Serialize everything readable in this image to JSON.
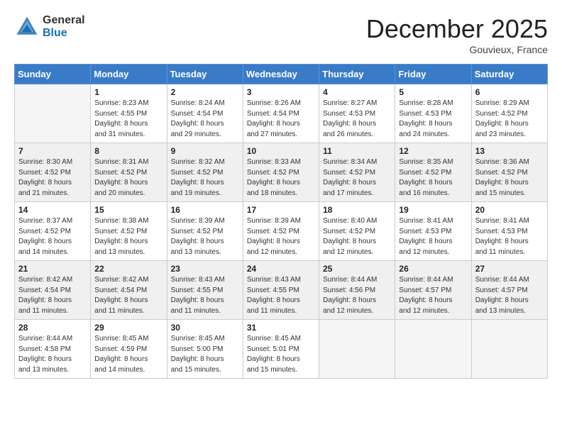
{
  "header": {
    "logo_general": "General",
    "logo_blue": "Blue",
    "month_title": "December 2025",
    "location": "Gouvieux, France"
  },
  "weekdays": [
    "Sunday",
    "Monday",
    "Tuesday",
    "Wednesday",
    "Thursday",
    "Friday",
    "Saturday"
  ],
  "weeks": [
    [
      {
        "day": "",
        "sunrise": "",
        "sunset": "",
        "daylight": ""
      },
      {
        "day": "1",
        "sunrise": "Sunrise: 8:23 AM",
        "sunset": "Sunset: 4:55 PM",
        "daylight": "Daylight: 8 hours and 31 minutes."
      },
      {
        "day": "2",
        "sunrise": "Sunrise: 8:24 AM",
        "sunset": "Sunset: 4:54 PM",
        "daylight": "Daylight: 8 hours and 29 minutes."
      },
      {
        "day": "3",
        "sunrise": "Sunrise: 8:26 AM",
        "sunset": "Sunset: 4:54 PM",
        "daylight": "Daylight: 8 hours and 27 minutes."
      },
      {
        "day": "4",
        "sunrise": "Sunrise: 8:27 AM",
        "sunset": "Sunset: 4:53 PM",
        "daylight": "Daylight: 8 hours and 26 minutes."
      },
      {
        "day": "5",
        "sunrise": "Sunrise: 8:28 AM",
        "sunset": "Sunset: 4:53 PM",
        "daylight": "Daylight: 8 hours and 24 minutes."
      },
      {
        "day": "6",
        "sunrise": "Sunrise: 8:29 AM",
        "sunset": "Sunset: 4:52 PM",
        "daylight": "Daylight: 8 hours and 23 minutes."
      }
    ],
    [
      {
        "day": "7",
        "sunrise": "Sunrise: 8:30 AM",
        "sunset": "Sunset: 4:52 PM",
        "daylight": "Daylight: 8 hours and 21 minutes."
      },
      {
        "day": "8",
        "sunrise": "Sunrise: 8:31 AM",
        "sunset": "Sunset: 4:52 PM",
        "daylight": "Daylight: 8 hours and 20 minutes."
      },
      {
        "day": "9",
        "sunrise": "Sunrise: 8:32 AM",
        "sunset": "Sunset: 4:52 PM",
        "daylight": "Daylight: 8 hours and 19 minutes."
      },
      {
        "day": "10",
        "sunrise": "Sunrise: 8:33 AM",
        "sunset": "Sunset: 4:52 PM",
        "daylight": "Daylight: 8 hours and 18 minutes."
      },
      {
        "day": "11",
        "sunrise": "Sunrise: 8:34 AM",
        "sunset": "Sunset: 4:52 PM",
        "daylight": "Daylight: 8 hours and 17 minutes."
      },
      {
        "day": "12",
        "sunrise": "Sunrise: 8:35 AM",
        "sunset": "Sunset: 4:52 PM",
        "daylight": "Daylight: 8 hours and 16 minutes."
      },
      {
        "day": "13",
        "sunrise": "Sunrise: 8:36 AM",
        "sunset": "Sunset: 4:52 PM",
        "daylight": "Daylight: 8 hours and 15 minutes."
      }
    ],
    [
      {
        "day": "14",
        "sunrise": "Sunrise: 8:37 AM",
        "sunset": "Sunset: 4:52 PM",
        "daylight": "Daylight: 8 hours and 14 minutes."
      },
      {
        "day": "15",
        "sunrise": "Sunrise: 8:38 AM",
        "sunset": "Sunset: 4:52 PM",
        "daylight": "Daylight: 8 hours and 13 minutes."
      },
      {
        "day": "16",
        "sunrise": "Sunrise: 8:39 AM",
        "sunset": "Sunset: 4:52 PM",
        "daylight": "Daylight: 8 hours and 13 minutes."
      },
      {
        "day": "17",
        "sunrise": "Sunrise: 8:39 AM",
        "sunset": "Sunset: 4:52 PM",
        "daylight": "Daylight: 8 hours and 12 minutes."
      },
      {
        "day": "18",
        "sunrise": "Sunrise: 8:40 AM",
        "sunset": "Sunset: 4:52 PM",
        "daylight": "Daylight: 8 hours and 12 minutes."
      },
      {
        "day": "19",
        "sunrise": "Sunrise: 8:41 AM",
        "sunset": "Sunset: 4:53 PM",
        "daylight": "Daylight: 8 hours and 12 minutes."
      },
      {
        "day": "20",
        "sunrise": "Sunrise: 8:41 AM",
        "sunset": "Sunset: 4:53 PM",
        "daylight": "Daylight: 8 hours and 11 minutes."
      }
    ],
    [
      {
        "day": "21",
        "sunrise": "Sunrise: 8:42 AM",
        "sunset": "Sunset: 4:54 PM",
        "daylight": "Daylight: 8 hours and 11 minutes."
      },
      {
        "day": "22",
        "sunrise": "Sunrise: 8:42 AM",
        "sunset": "Sunset: 4:54 PM",
        "daylight": "Daylight: 8 hours and 11 minutes."
      },
      {
        "day": "23",
        "sunrise": "Sunrise: 8:43 AM",
        "sunset": "Sunset: 4:55 PM",
        "daylight": "Daylight: 8 hours and 11 minutes."
      },
      {
        "day": "24",
        "sunrise": "Sunrise: 8:43 AM",
        "sunset": "Sunset: 4:55 PM",
        "daylight": "Daylight: 8 hours and 11 minutes."
      },
      {
        "day": "25",
        "sunrise": "Sunrise: 8:44 AM",
        "sunset": "Sunset: 4:56 PM",
        "daylight": "Daylight: 8 hours and 12 minutes."
      },
      {
        "day": "26",
        "sunrise": "Sunrise: 8:44 AM",
        "sunset": "Sunset: 4:57 PM",
        "daylight": "Daylight: 8 hours and 12 minutes."
      },
      {
        "day": "27",
        "sunrise": "Sunrise: 8:44 AM",
        "sunset": "Sunset: 4:57 PM",
        "daylight": "Daylight: 8 hours and 13 minutes."
      }
    ],
    [
      {
        "day": "28",
        "sunrise": "Sunrise: 8:44 AM",
        "sunset": "Sunset: 4:58 PM",
        "daylight": "Daylight: 8 hours and 13 minutes."
      },
      {
        "day": "29",
        "sunrise": "Sunrise: 8:45 AM",
        "sunset": "Sunset: 4:59 PM",
        "daylight": "Daylight: 8 hours and 14 minutes."
      },
      {
        "day": "30",
        "sunrise": "Sunrise: 8:45 AM",
        "sunset": "Sunset: 5:00 PM",
        "daylight": "Daylight: 8 hours and 15 minutes."
      },
      {
        "day": "31",
        "sunrise": "Sunrise: 8:45 AM",
        "sunset": "Sunset: 5:01 PM",
        "daylight": "Daylight: 8 hours and 15 minutes."
      },
      {
        "day": "",
        "sunrise": "",
        "sunset": "",
        "daylight": ""
      },
      {
        "day": "",
        "sunrise": "",
        "sunset": "",
        "daylight": ""
      },
      {
        "day": "",
        "sunrise": "",
        "sunset": "",
        "daylight": ""
      }
    ]
  ]
}
